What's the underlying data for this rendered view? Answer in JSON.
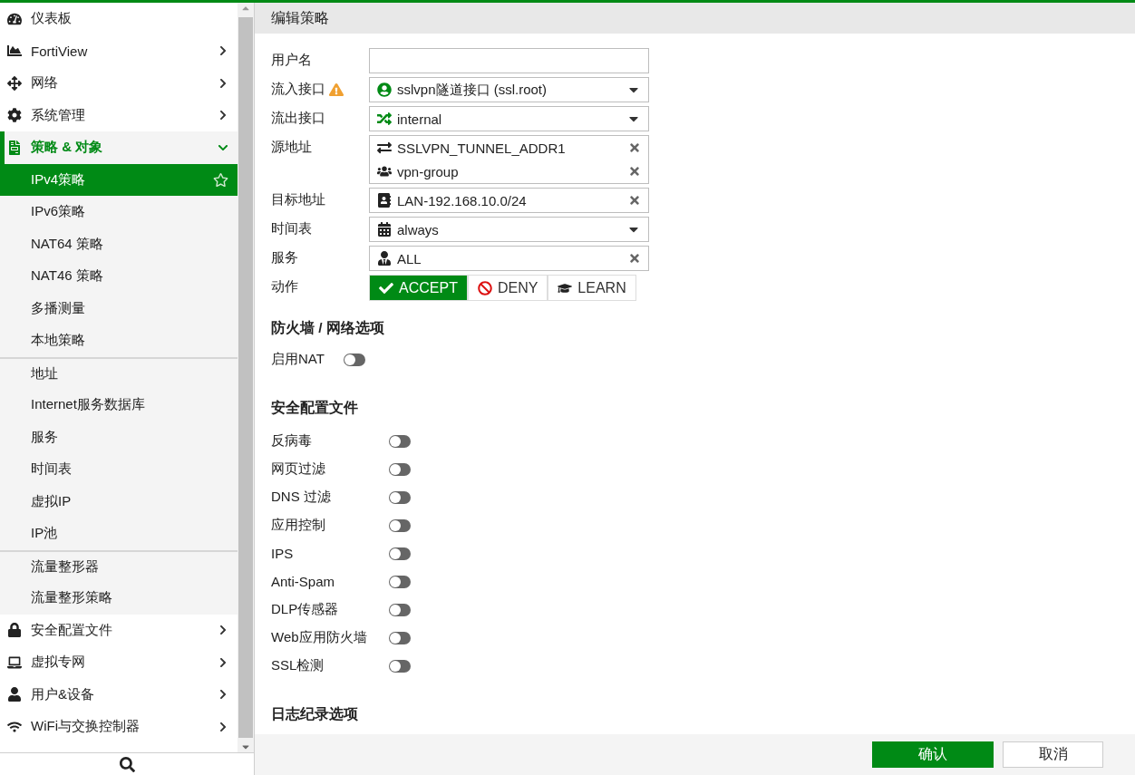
{
  "sidebar": {
    "items": [
      {
        "label": "仪表板",
        "has_submenu": false,
        "expanded": false
      },
      {
        "label": "FortiView",
        "has_submenu": true,
        "expanded": false
      },
      {
        "label": "网络",
        "has_submenu": true,
        "expanded": false
      },
      {
        "label": "系统管理",
        "has_submenu": true,
        "expanded": false
      },
      {
        "label": "策略 & 对象",
        "has_submenu": true,
        "expanded": true,
        "sections": [
          {
            "children": [
              {
                "label": "IPv4策略",
                "selected": true
              },
              {
                "label": "IPv6策略",
                "selected": false
              },
              {
                "label": "NAT64 策略",
                "selected": false
              },
              {
                "label": "NAT46 策略",
                "selected": false
              },
              {
                "label": "多播测量",
                "selected": false
              },
              {
                "label": "本地策略",
                "selected": false
              }
            ]
          },
          {
            "children": [
              {
                "label": "地址",
                "selected": false
              },
              {
                "label": "Internet服务数据库",
                "selected": false
              },
              {
                "label": "服务",
                "selected": false
              },
              {
                "label": "时间表",
                "selected": false
              },
              {
                "label": "虚拟IP",
                "selected": false
              },
              {
                "label": "IP池",
                "selected": false
              }
            ]
          },
          {
            "children": [
              {
                "label": "流量整形器",
                "selected": false
              },
              {
                "label": "流量整形策略",
                "selected": false
              }
            ]
          }
        ]
      },
      {
        "label": "安全配置文件",
        "has_submenu": true,
        "expanded": false
      },
      {
        "label": "虚拟专网",
        "has_submenu": true,
        "expanded": false
      },
      {
        "label": "用户&设备",
        "has_submenu": true,
        "expanded": false
      },
      {
        "label": "WiFi与交换控制器",
        "has_submenu": true,
        "expanded": false
      }
    ]
  },
  "header": {
    "title": "编辑策略"
  },
  "form": {
    "fields": [
      {
        "kind": "text",
        "label": "用户名"
      },
      {
        "kind": "select",
        "label": "流入接口",
        "warning": true,
        "entries": [
          {
            "kind": "tunnel",
            "value": "sslvpn隧道接口 (ssl.root)"
          }
        ]
      },
      {
        "kind": "select",
        "label": "流出接口",
        "entries": [
          {
            "kind": "interface",
            "value": "internal"
          }
        ]
      },
      {
        "kind": "multi",
        "label": "源地址",
        "entries": [
          {
            "kind": "address",
            "value": "SSLVPN_TUNNEL_ADDR1"
          },
          {
            "kind": "group",
            "value": "vpn-group"
          }
        ]
      },
      {
        "kind": "multi",
        "label": "目标地址",
        "entries": [
          {
            "kind": "book",
            "value": "LAN-192.168.10.0/24"
          }
        ]
      },
      {
        "kind": "select",
        "label": "时间表",
        "entries": [
          {
            "kind": "schedule",
            "value": "always"
          }
        ]
      },
      {
        "kind": "multi",
        "label": "服务",
        "entries": [
          {
            "kind": "service",
            "value": "ALL"
          }
        ]
      },
      {
        "kind": "action",
        "label": "动作",
        "options": [
          {
            "kind": "accept",
            "label": "ACCEPT",
            "selected": true
          },
          {
            "kind": "deny",
            "label": "DENY",
            "selected": false
          },
          {
            "kind": "learn",
            "label": "LEARN",
            "selected": false
          }
        ]
      }
    ]
  },
  "sections": [
    {
      "title": "防火墙 / 网络选项",
      "toggles": [
        {
          "label": "启用NAT",
          "on": false
        }
      ]
    },
    {
      "title": "安全配置文件",
      "toggles": [
        {
          "label": "反病毒",
          "on": false
        },
        {
          "label": "网页过滤",
          "on": false
        },
        {
          "label": "DNS 过滤",
          "on": false
        },
        {
          "label": "应用控制",
          "on": false
        },
        {
          "label": "IPS",
          "on": false
        },
        {
          "label": "Anti-Spam",
          "on": false
        },
        {
          "label": "DLP传感器",
          "on": false
        },
        {
          "label": "Web应用防火墙",
          "on": false
        },
        {
          "label": "SSL检测",
          "on": false
        }
      ]
    },
    {
      "title": "日志纪录选项"
    }
  ],
  "footer": {
    "buttons": [
      {
        "kind": "primary",
        "label": "确认"
      },
      {
        "kind": "secondary",
        "label": "取消"
      }
    ]
  }
}
